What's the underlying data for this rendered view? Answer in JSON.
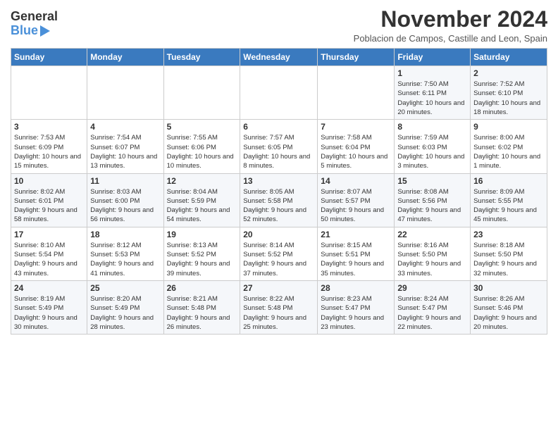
{
  "logo": {
    "general": "General",
    "blue": "Blue",
    "tagline": ""
  },
  "header": {
    "month_year": "November 2024",
    "location": "Poblacion de Campos, Castille and Leon, Spain"
  },
  "days_of_week": [
    "Sunday",
    "Monday",
    "Tuesday",
    "Wednesday",
    "Thursday",
    "Friday",
    "Saturday"
  ],
  "weeks": [
    [
      {
        "day": "",
        "info": ""
      },
      {
        "day": "",
        "info": ""
      },
      {
        "day": "",
        "info": ""
      },
      {
        "day": "",
        "info": ""
      },
      {
        "day": "",
        "info": ""
      },
      {
        "day": "1",
        "info": "Sunrise: 7:50 AM\nSunset: 6:11 PM\nDaylight: 10 hours and 20 minutes."
      },
      {
        "day": "2",
        "info": "Sunrise: 7:52 AM\nSunset: 6:10 PM\nDaylight: 10 hours and 18 minutes."
      }
    ],
    [
      {
        "day": "3",
        "info": "Sunrise: 7:53 AM\nSunset: 6:09 PM\nDaylight: 10 hours and 15 minutes."
      },
      {
        "day": "4",
        "info": "Sunrise: 7:54 AM\nSunset: 6:07 PM\nDaylight: 10 hours and 13 minutes."
      },
      {
        "day": "5",
        "info": "Sunrise: 7:55 AM\nSunset: 6:06 PM\nDaylight: 10 hours and 10 minutes."
      },
      {
        "day": "6",
        "info": "Sunrise: 7:57 AM\nSunset: 6:05 PM\nDaylight: 10 hours and 8 minutes."
      },
      {
        "day": "7",
        "info": "Sunrise: 7:58 AM\nSunset: 6:04 PM\nDaylight: 10 hours and 5 minutes."
      },
      {
        "day": "8",
        "info": "Sunrise: 7:59 AM\nSunset: 6:03 PM\nDaylight: 10 hours and 3 minutes."
      },
      {
        "day": "9",
        "info": "Sunrise: 8:00 AM\nSunset: 6:02 PM\nDaylight: 10 hours and 1 minute."
      }
    ],
    [
      {
        "day": "10",
        "info": "Sunrise: 8:02 AM\nSunset: 6:01 PM\nDaylight: 9 hours and 58 minutes."
      },
      {
        "day": "11",
        "info": "Sunrise: 8:03 AM\nSunset: 6:00 PM\nDaylight: 9 hours and 56 minutes."
      },
      {
        "day": "12",
        "info": "Sunrise: 8:04 AM\nSunset: 5:59 PM\nDaylight: 9 hours and 54 minutes."
      },
      {
        "day": "13",
        "info": "Sunrise: 8:05 AM\nSunset: 5:58 PM\nDaylight: 9 hours and 52 minutes."
      },
      {
        "day": "14",
        "info": "Sunrise: 8:07 AM\nSunset: 5:57 PM\nDaylight: 9 hours and 50 minutes."
      },
      {
        "day": "15",
        "info": "Sunrise: 8:08 AM\nSunset: 5:56 PM\nDaylight: 9 hours and 47 minutes."
      },
      {
        "day": "16",
        "info": "Sunrise: 8:09 AM\nSunset: 5:55 PM\nDaylight: 9 hours and 45 minutes."
      }
    ],
    [
      {
        "day": "17",
        "info": "Sunrise: 8:10 AM\nSunset: 5:54 PM\nDaylight: 9 hours and 43 minutes."
      },
      {
        "day": "18",
        "info": "Sunrise: 8:12 AM\nSunset: 5:53 PM\nDaylight: 9 hours and 41 minutes."
      },
      {
        "day": "19",
        "info": "Sunrise: 8:13 AM\nSunset: 5:52 PM\nDaylight: 9 hours and 39 minutes."
      },
      {
        "day": "20",
        "info": "Sunrise: 8:14 AM\nSunset: 5:52 PM\nDaylight: 9 hours and 37 minutes."
      },
      {
        "day": "21",
        "info": "Sunrise: 8:15 AM\nSunset: 5:51 PM\nDaylight: 9 hours and 35 minutes."
      },
      {
        "day": "22",
        "info": "Sunrise: 8:16 AM\nSunset: 5:50 PM\nDaylight: 9 hours and 33 minutes."
      },
      {
        "day": "23",
        "info": "Sunrise: 8:18 AM\nSunset: 5:50 PM\nDaylight: 9 hours and 32 minutes."
      }
    ],
    [
      {
        "day": "24",
        "info": "Sunrise: 8:19 AM\nSunset: 5:49 PM\nDaylight: 9 hours and 30 minutes."
      },
      {
        "day": "25",
        "info": "Sunrise: 8:20 AM\nSunset: 5:49 PM\nDaylight: 9 hours and 28 minutes."
      },
      {
        "day": "26",
        "info": "Sunrise: 8:21 AM\nSunset: 5:48 PM\nDaylight: 9 hours and 26 minutes."
      },
      {
        "day": "27",
        "info": "Sunrise: 8:22 AM\nSunset: 5:48 PM\nDaylight: 9 hours and 25 minutes."
      },
      {
        "day": "28",
        "info": "Sunrise: 8:23 AM\nSunset: 5:47 PM\nDaylight: 9 hours and 23 minutes."
      },
      {
        "day": "29",
        "info": "Sunrise: 8:24 AM\nSunset: 5:47 PM\nDaylight: 9 hours and 22 minutes."
      },
      {
        "day": "30",
        "info": "Sunrise: 8:26 AM\nSunset: 5:46 PM\nDaylight: 9 hours and 20 minutes."
      }
    ]
  ]
}
